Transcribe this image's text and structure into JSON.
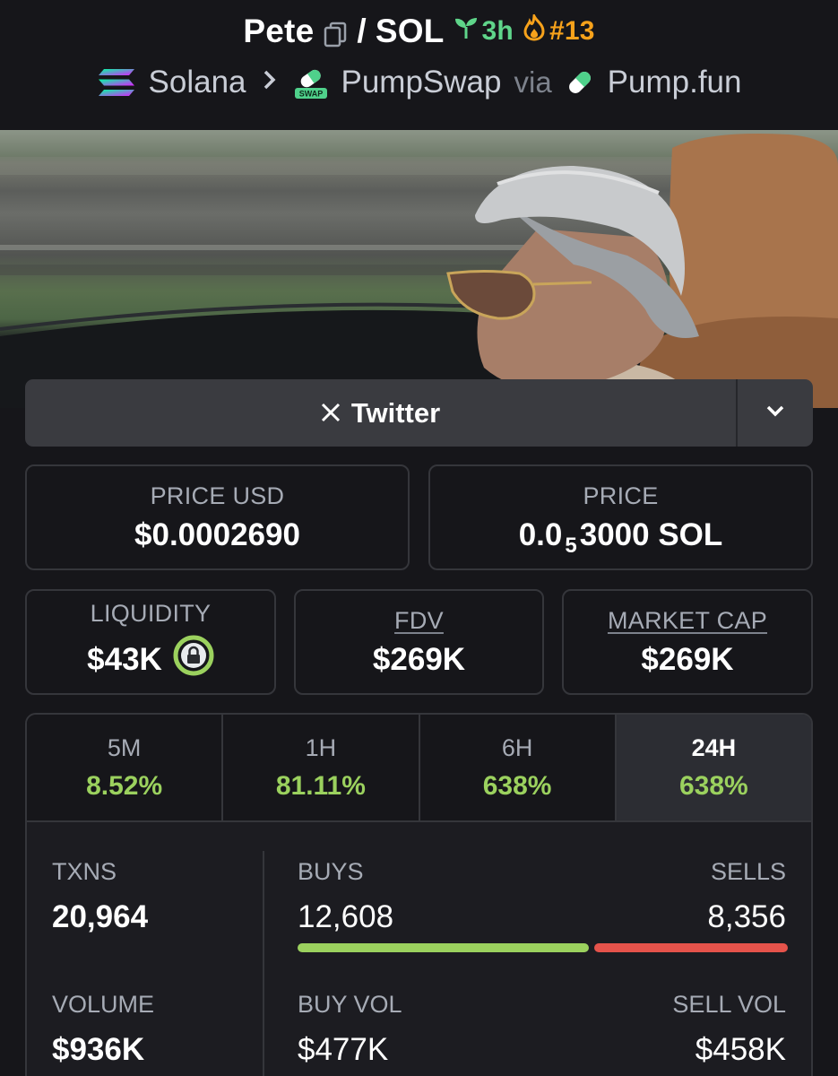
{
  "header": {
    "token_name": "Pete",
    "separator": "/",
    "quote": "SOL",
    "age": "3h",
    "rank": "#13",
    "chain": "Solana",
    "dex": "PumpSwap",
    "dex_logo_text": "SWAP",
    "via": "via",
    "launchpad": "Pump.fun"
  },
  "social": {
    "button_label": "Twitter"
  },
  "price": {
    "usd_label": "PRICE USD",
    "usd_value": "$0.0002690",
    "native_label": "PRICE",
    "native_prefix": "0.0",
    "native_zero_count": "5",
    "native_suffix": "3000 SOL"
  },
  "metrics": {
    "liquidity_label": "LIQUIDITY",
    "liquidity_value": "$43K",
    "fdv_label": "FDV",
    "fdv_value": "$269K",
    "mcap_label": "MARKET CAP",
    "mcap_value": "$269K"
  },
  "timeframes": [
    {
      "label": "5M",
      "change": "8.52%"
    },
    {
      "label": "1H",
      "change": "81.11%"
    },
    {
      "label": "6H",
      "change": "638%"
    },
    {
      "label": "24H",
      "change": "638%"
    }
  ],
  "selected_timeframe": "24H",
  "txns": {
    "label": "TXNS",
    "value": "20,964",
    "buys_label": "BUYS",
    "buys_value": "12,608",
    "sells_label": "SELLS",
    "sells_value": "8,356",
    "buy_fraction": 0.6014
  },
  "volume": {
    "label": "VOLUME",
    "value": "$936K",
    "buy_label": "BUY VOL",
    "buy_value": "$477K",
    "sell_label": "SELL VOL",
    "sell_value": "$458K"
  },
  "colors": {
    "background": "#16161a",
    "positive": "#9bd15e",
    "negative": "#e5534b",
    "age_green": "#5fd58a",
    "rank_orange": "#f7a21b"
  }
}
